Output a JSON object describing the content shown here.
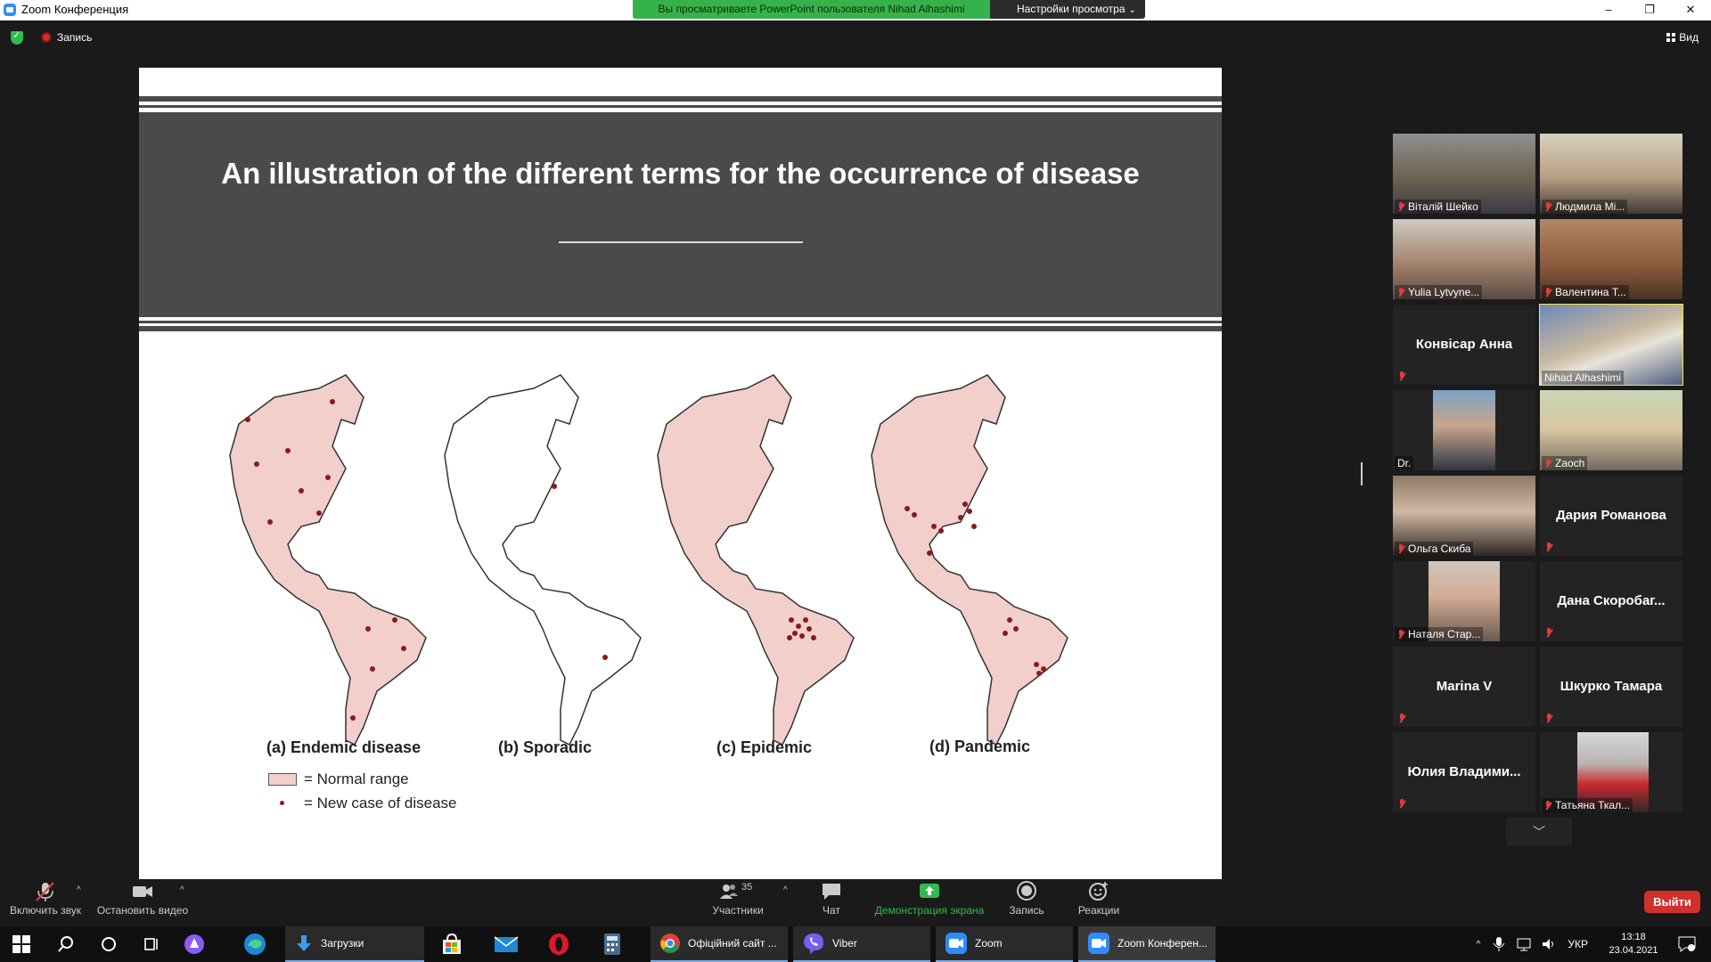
{
  "window": {
    "title": "Zoom Конференция",
    "share_banner": "Вы просматриваете PowerPoint пользователя Nihad Alhashimi",
    "view_options": "Настройки просмотра",
    "controls": [
      "–",
      "❐",
      "✕"
    ]
  },
  "meeting_top": {
    "recording_label": "Запись",
    "view_label": "Вид"
  },
  "slide": {
    "title": "An illustration of the different terms for the occurrence of disease",
    "map_labels": [
      "(a) Endemic disease",
      "(b) Sporadic",
      "(c) Epidemic",
      "(d) Pandemic"
    ],
    "legend": [
      {
        "symbol": "box",
        "text": "= Normal range"
      },
      {
        "symbol": "dot",
        "text": "= New case of disease"
      }
    ],
    "colors": {
      "range_fill": "#f2cfcb",
      "case_dot": "#8b1a1a",
      "band": "#4a4a4c"
    }
  },
  "participants": [
    {
      "name": "Віталій Шейко",
      "video": true,
      "muted": true
    },
    {
      "name": "Людмила Мі...",
      "video": true,
      "muted": true
    },
    {
      "name": "Yulia Lytvyne...",
      "video": true,
      "muted": true
    },
    {
      "name": "Валентина Т...",
      "video": true,
      "muted": true
    },
    {
      "name": "Конвісар Анна",
      "video": false,
      "muted": true
    },
    {
      "name": "Nihad Alhashimi",
      "video": true,
      "muted": false,
      "active": true
    },
    {
      "name": "Dr.",
      "video": true,
      "muted": false
    },
    {
      "name": "Zaoch",
      "video": true,
      "muted": true
    },
    {
      "name": "Ольга Скиба",
      "video": true,
      "muted": true
    },
    {
      "name": "Дария Романова",
      "video": false,
      "muted": true
    },
    {
      "name": "Наталя Стар...",
      "video": true,
      "muted": true
    },
    {
      "name": "Дана  Скоробаг...",
      "video": false,
      "muted": true
    },
    {
      "name": "Marina V",
      "video": false,
      "muted": true
    },
    {
      "name": "Шкурко Тамара",
      "video": false,
      "muted": true
    },
    {
      "name": "Юлия  Владими...",
      "video": false,
      "muted": true
    },
    {
      "name": "Татьяна Ткал...",
      "video": true,
      "muted": true
    }
  ],
  "toolbar": {
    "unmute": "Включить звук",
    "stop_video": "Остановить видео",
    "participants": "Участники",
    "participants_count": "35",
    "chat": "Чат",
    "share": "Демонстрация экрана",
    "record": "Запись",
    "reactions": "Реакции",
    "leave": "Выйти"
  },
  "taskbar": {
    "downloads": "Загрузки",
    "chrome": "Офіційний сайт ...",
    "viber": "Viber",
    "zoom": "Zoom",
    "zoom_meeting": "Zoom Конферен...",
    "lang": "УКР",
    "time": "13:18",
    "date": "23.04.2021"
  }
}
